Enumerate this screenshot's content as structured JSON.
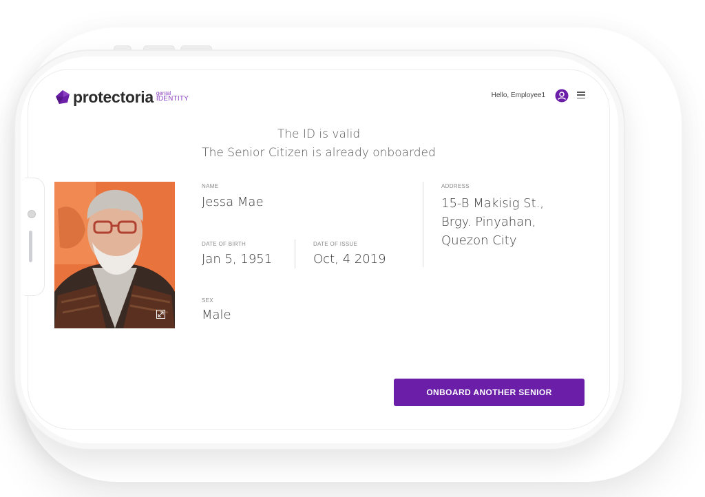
{
  "header": {
    "brand": "protectoria",
    "brand_sub_top": "genial",
    "brand_sub_bottom": "IDENTITY",
    "greeting": "Hello, Employee1",
    "avatar_icon": "user-circle-icon",
    "menu_icon": "hamburger-menu-icon"
  },
  "status": {
    "line1": "The ID is valid",
    "line2": "The Senior Citizen is already onboarded"
  },
  "photo": {
    "expand_icon": "expand-icon"
  },
  "fields": {
    "name_label": "NAME",
    "name_value": "Jessa Mae",
    "dob_label": "DATE OF BIRTH",
    "dob_value": "Jan 5, 1951",
    "doi_label": "DATE OF ISSUE",
    "doi_value": "Oct, 4 2019",
    "sex_label": "SEX",
    "sex_value": "Male",
    "address_label": "ADDRESS",
    "address_lines": [
      "15-B Makisig St.,",
      "Brgy. Pinyahan,",
      "Quezon City"
    ]
  },
  "actions": {
    "onboard_label": "ONBOARD ANOTHER SENIOR"
  },
  "colors": {
    "accent": "#6b1fa8",
    "accent_light": "#8a3fc0"
  }
}
